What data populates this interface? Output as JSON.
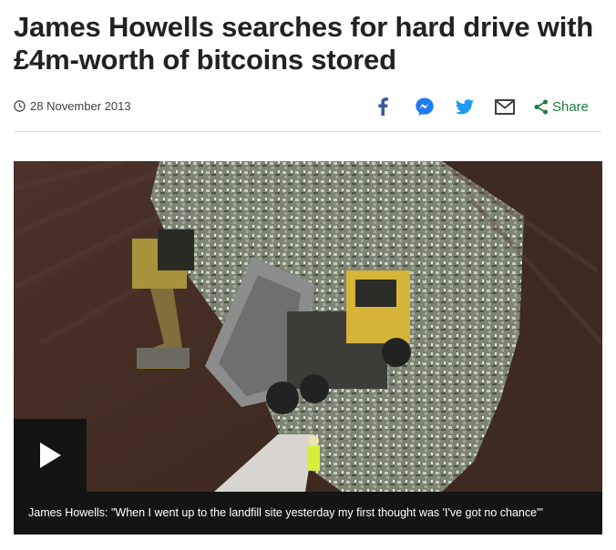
{
  "article": {
    "headline": "James Howells searches for hard drive with £4m-worth of bitcoins stored",
    "date": "28 November 2013"
  },
  "share": {
    "label": "Share",
    "icons": [
      "clock-icon",
      "facebook-icon",
      "messenger-icon",
      "twitter-icon",
      "email-icon",
      "share-icon"
    ]
  },
  "media": {
    "caption": "James Howells: \"When I went up to the landfill site yesterday my first thought was 'I've got no chance'\"",
    "play_icon": "play-icon"
  },
  "colors": {
    "facebook": "#3b5998",
    "messenger": "#1f7bf2",
    "twitter": "#1d9bf0",
    "share_green": "#1d7a3c",
    "caption_bg": "#141414"
  }
}
